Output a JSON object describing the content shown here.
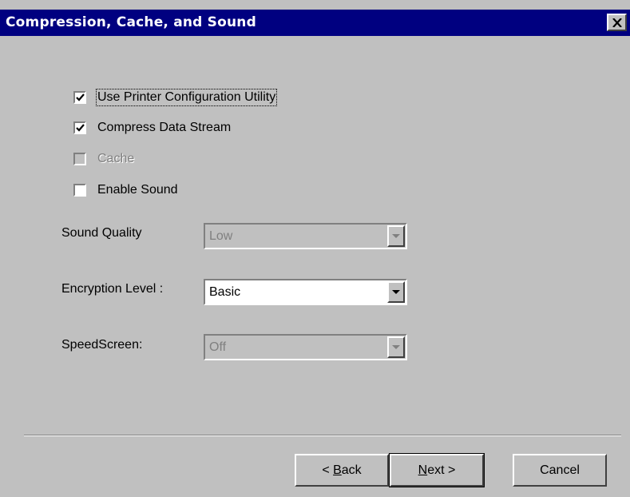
{
  "window": {
    "title": "Compression, Cache, and Sound",
    "close_label": "✕"
  },
  "checkboxes": [
    {
      "label": "Use Printer Configuration Utility",
      "checked": true,
      "enabled": true
    },
    {
      "label": "Compress Data Stream",
      "checked": true,
      "enabled": true
    },
    {
      "label": "Cache",
      "checked": false,
      "enabled": false
    },
    {
      "label": "Enable Sound",
      "checked": false,
      "enabled": true
    }
  ],
  "fields": {
    "sound_quality": {
      "label": "Sound Quality",
      "value": "Low",
      "enabled": false
    },
    "encryption_level": {
      "label": "Encryption Level :",
      "value": "Basic",
      "enabled": true
    },
    "speedscreen": {
      "label": "SpeedScreen:",
      "value": "Off",
      "enabled": false
    }
  },
  "buttons": {
    "back": {
      "prefix": "< ",
      "mnemonic": "B",
      "rest": "ack"
    },
    "next": {
      "mnemonic": "N",
      "rest": "ext >"
    },
    "cancel": {
      "label": "Cancel"
    }
  },
  "colors": {
    "titlebar": "#000080",
    "face": "#c0c0c0",
    "disabled_text": "#808080"
  }
}
